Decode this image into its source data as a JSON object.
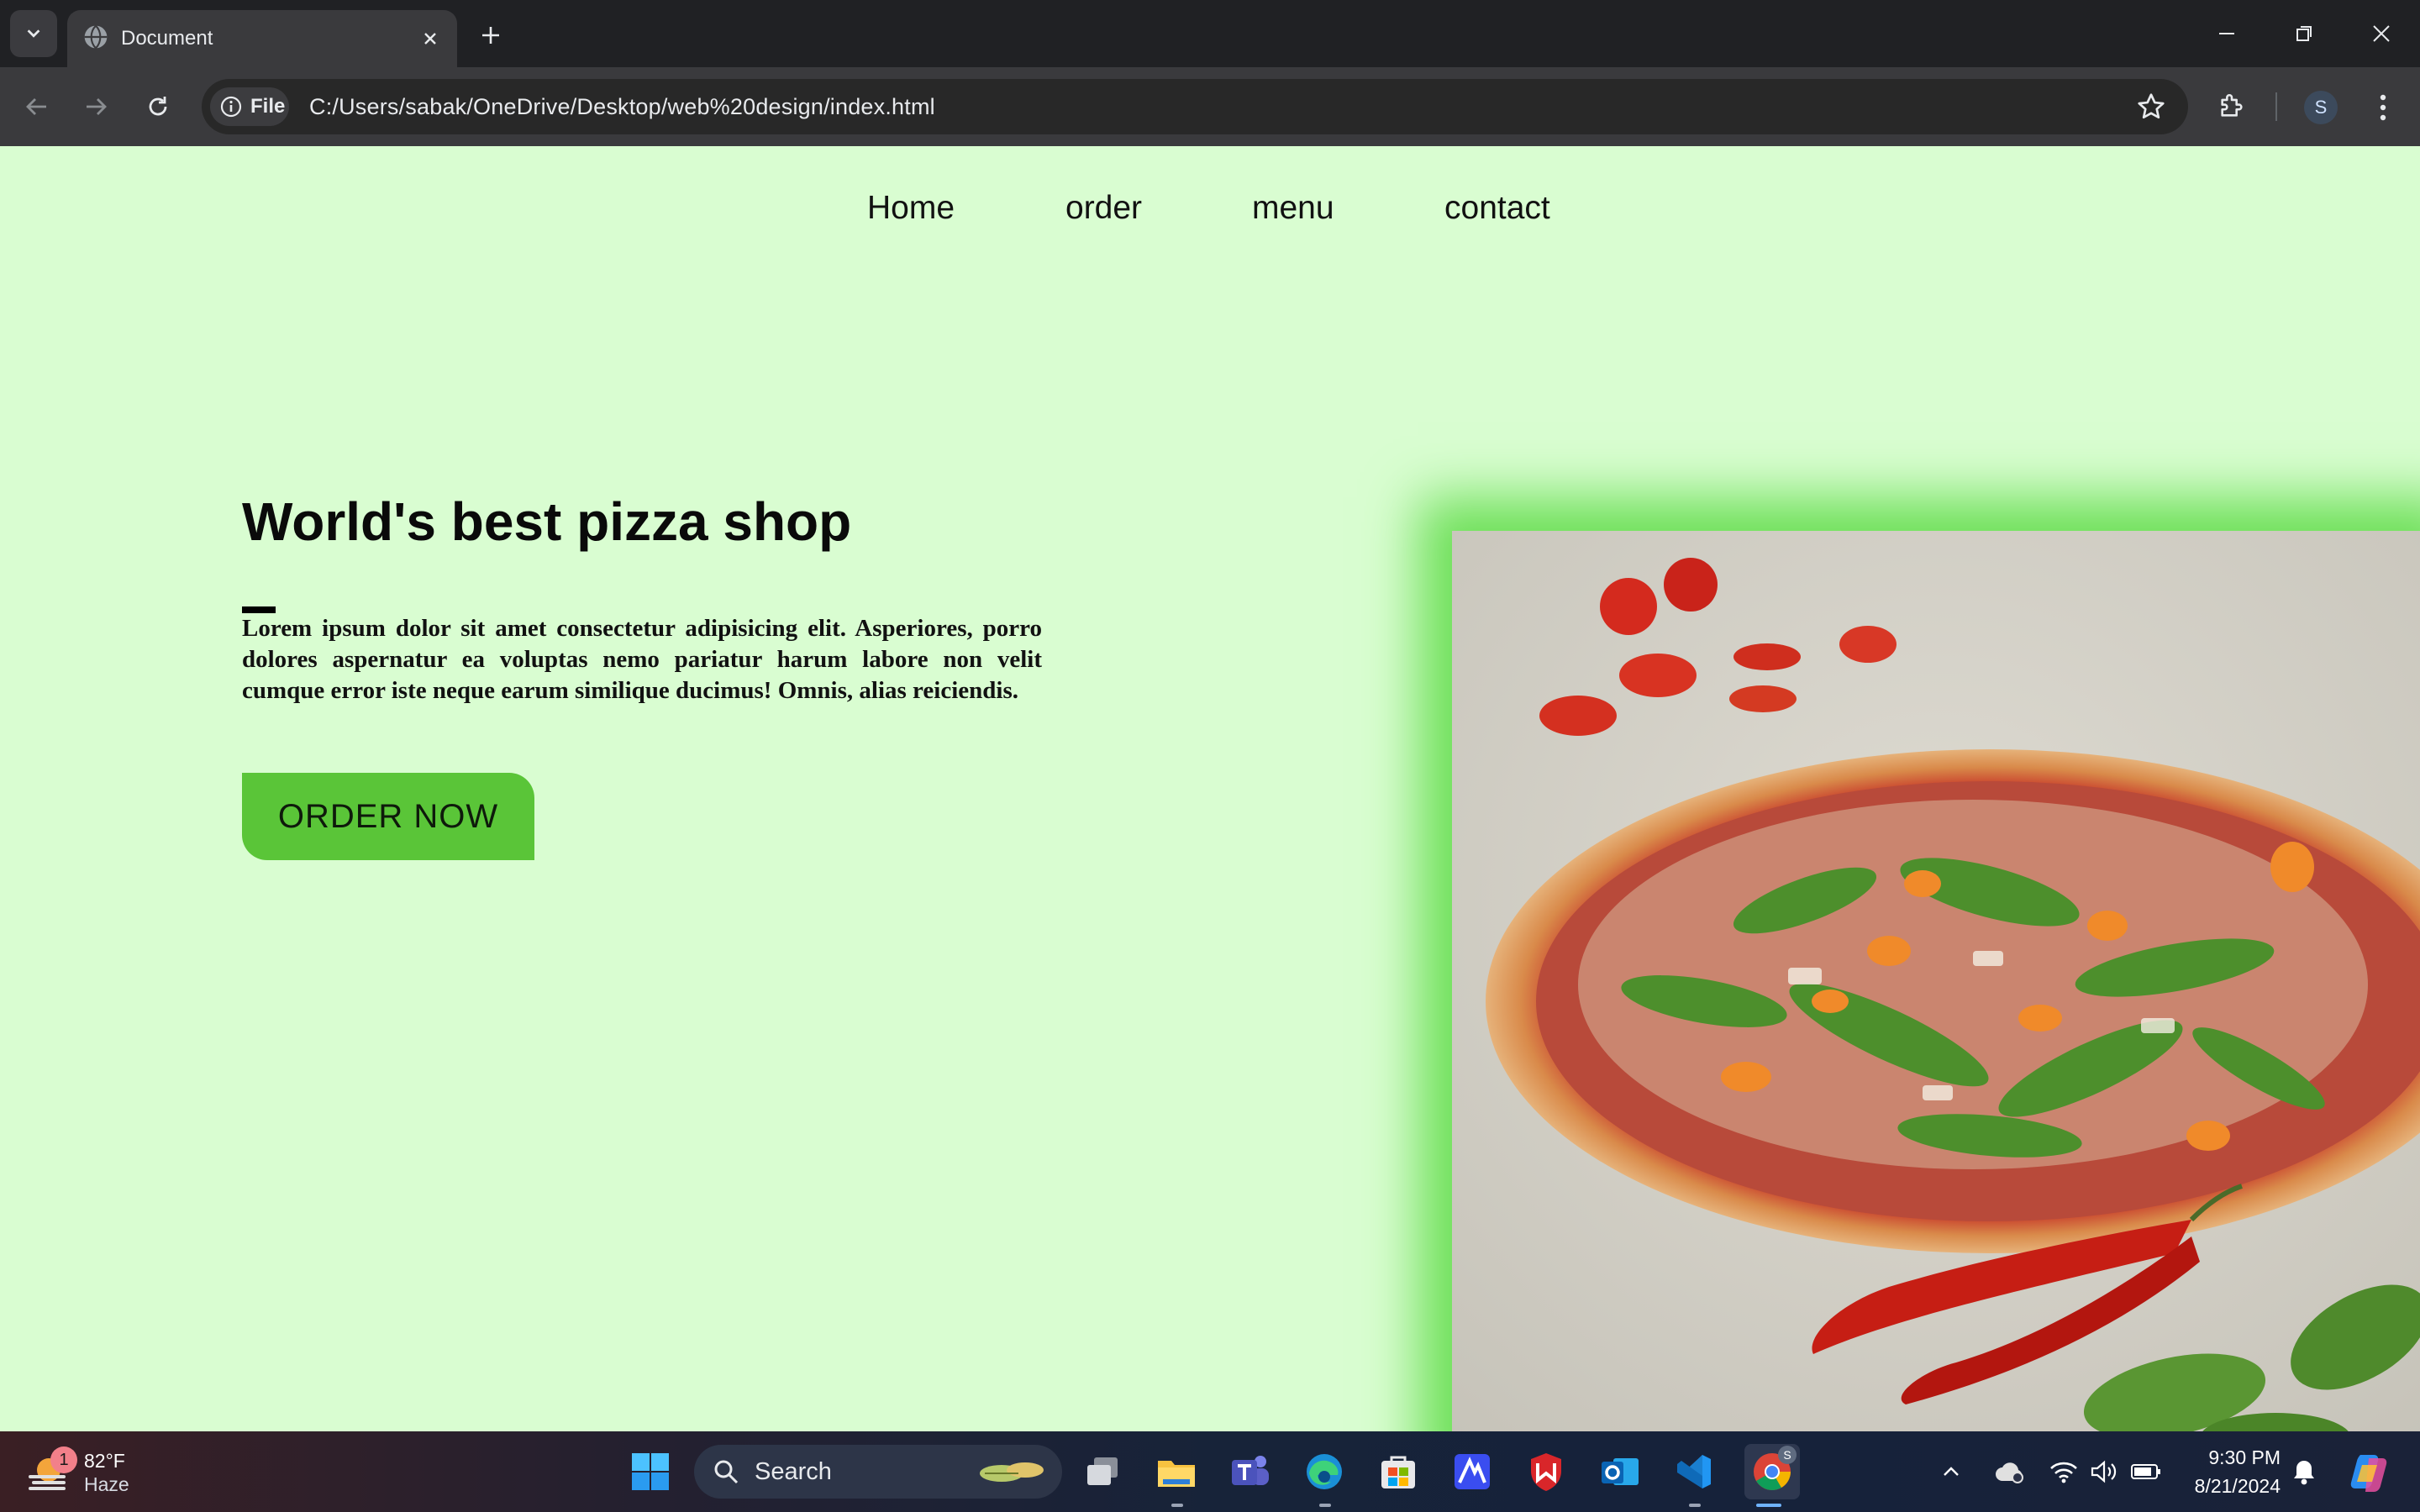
{
  "browser": {
    "tab_title": "Document",
    "site_chip_label": "File",
    "url": "C:/Users/sabak/OneDrive/Desktop/web%20design/index.html",
    "profile_initial": "S"
  },
  "page": {
    "nav": [
      "Home",
      "order",
      "menu",
      "contact"
    ],
    "hero_title": "World's best pizza shop",
    "hero_text": "Lorem ipsum dolor sit amet consectetur adipisicing elit. Asperiores, porro dolores aspernatur ea voluptas nemo pariatur harum labore non velit cumque error iste neque earum similique ducimus! Omnis, alias reiciendis.",
    "order_button": "ORDER NOW",
    "colors": {
      "background": "#d9fdd1",
      "accent_green": "#5ac538",
      "glow": "#6fe05a"
    }
  },
  "taskbar": {
    "weather_temp": "82°F",
    "weather_condition": "Haze",
    "weather_badge": "1",
    "search_label": "Search",
    "time": "9:30 PM",
    "date": "8/21/2024",
    "chrome_badge": "S"
  }
}
